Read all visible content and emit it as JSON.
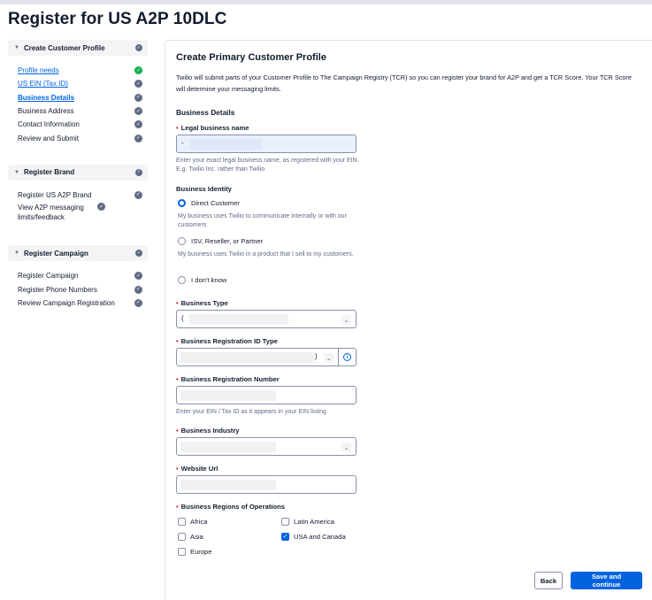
{
  "page": {
    "title": "Register for US A2P 10DLC"
  },
  "sidebar": {
    "sections": [
      {
        "title": "Create Customer Profile",
        "steps": [
          {
            "label": "Profile needs",
            "state": "done"
          },
          {
            "label": "US EIN (Tax ID)",
            "state": "pending"
          },
          {
            "label": "Business Details",
            "state": "current"
          },
          {
            "label": "Business Address",
            "state": "pending"
          },
          {
            "label": "Contact Information",
            "state": "pending"
          },
          {
            "label": "Review and Submit",
            "state": "pending"
          }
        ]
      },
      {
        "title": "Register Brand",
        "steps": [
          {
            "label": "Register US A2P Brand",
            "state": "pending"
          },
          {
            "label": "View A2P messaging limits/feedback",
            "state": "pending"
          }
        ]
      },
      {
        "title": "Register Campaign",
        "steps": [
          {
            "label": "Register Campaign",
            "state": "pending"
          },
          {
            "label": "Register Phone Numbers",
            "state": "pending"
          },
          {
            "label": "Review Campaign Registration",
            "state": "pending"
          }
        ]
      }
    ]
  },
  "form": {
    "title": "Create Primary Customer Profile",
    "intro": "Twilio will submit parts of your Customer Profile to The Campaign Registry (TCR) so you can register your brand for A2P and get a TCR Score. Your TCR Score will determine your messaging limits.",
    "section_heading": "Business Details",
    "legal_name": {
      "label": "Legal business name",
      "value": "-",
      "help": "Enter your exact legal business name, as registered with your EIN. E.g. Twilio Inc. rather than Twilio"
    },
    "identity": {
      "label": "Business Identity",
      "options": [
        {
          "label": "Direct Customer",
          "help": "My business uses Twilio to communicate internally or with our customers",
          "selected": true
        },
        {
          "label": "ISV, Reseller, or Partner",
          "help": "My business uses Twilio in a product that I sell to my customers.",
          "selected": false
        },
        {
          "label": "I don't know",
          "help": "",
          "selected": false
        }
      ]
    },
    "business_type": {
      "label": "Business Type",
      "value": "("
    },
    "reg_id_type": {
      "label": "Business Registration ID Type",
      "value": ")"
    },
    "reg_number": {
      "label": "Business Registration Number",
      "help": "Enter your EIN / Tax ID as it appears in your EIN listing"
    },
    "industry": {
      "label": "Business Industry"
    },
    "website": {
      "label": "Website Url"
    },
    "regions": {
      "label": "Business Regions of Operations",
      "options": [
        {
          "label": "Africa",
          "checked": false
        },
        {
          "label": "Latin America",
          "checked": false
        },
        {
          "label": "Asia",
          "checked": false
        },
        {
          "label": "USA and Canada",
          "checked": true
        },
        {
          "label": "Europe",
          "checked": false
        }
      ]
    },
    "buttons": {
      "back": "Back",
      "save": "Save and continue"
    }
  },
  "icons": {
    "check": "check-circle-icon",
    "chevron": "chevron-down-icon",
    "caret": "caret-down-icon",
    "info": "info-icon"
  },
  "colors": {
    "accent": "#0263e0",
    "success": "#14b053",
    "required": "#d61f1f"
  }
}
